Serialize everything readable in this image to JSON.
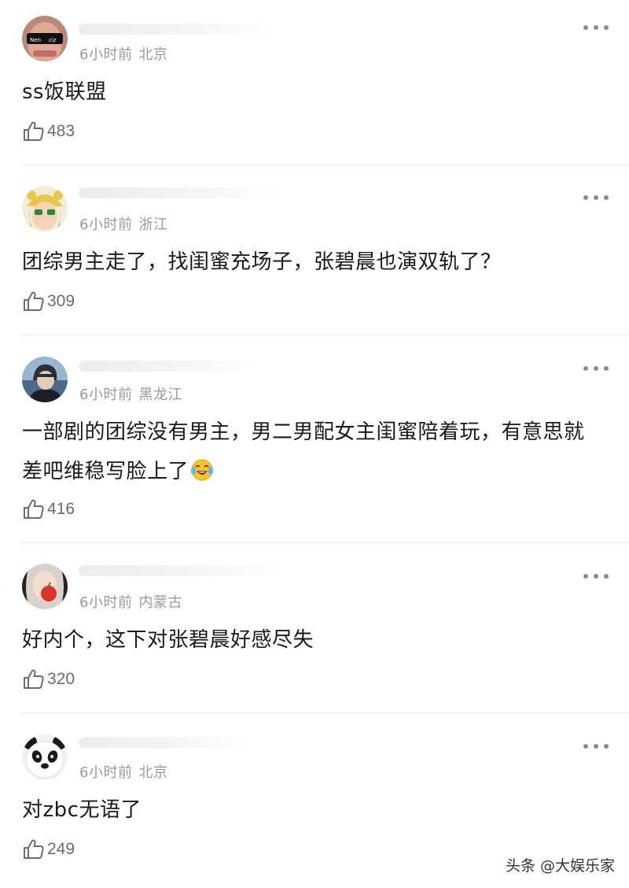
{
  "comments": [
    {
      "time": "6小时前",
      "location": "北京",
      "text": "ss饭联盟",
      "likes": "483",
      "avatar_icon": "avatar-sunglasses-man"
    },
    {
      "time": "6小时前",
      "location": "浙江",
      "text": "团综男主走了，找闺蜜充场子，张碧晨也演双轨了？",
      "likes": "309",
      "avatar_icon": "avatar-girl-yellow-hat"
    },
    {
      "time": "6小时前",
      "location": "黑龙江",
      "text": "一部剧的团综没有男主，男二男配女主闺蜜陪着玩，有意思就差吧维稳写脸上了",
      "likes": "416",
      "avatar_icon": "avatar-anime-character",
      "emoji": "laughing-crying-emoji"
    },
    {
      "time": "6小时前",
      "location": "内蒙古",
      "text": "好内个，这下对张碧晨好感尽失",
      "likes": "320",
      "avatar_icon": "avatar-girl-with-apple"
    },
    {
      "time": "6小时前",
      "location": "北京",
      "text": "对zbc无语了",
      "likes": "249",
      "avatar_icon": "avatar-panda"
    }
  ],
  "watermark": "头条 @大娱乐家",
  "colors": {
    "meta_text": "#9a9a9a",
    "body_text": "#1a1a1a",
    "like_text": "#6c6c6c",
    "divider": "#e8e8e8"
  }
}
